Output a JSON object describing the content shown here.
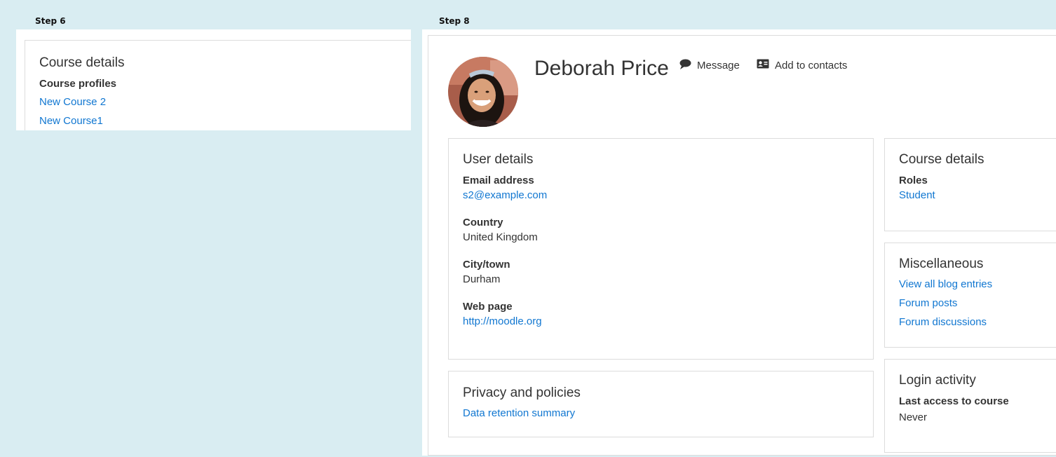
{
  "labels": {
    "step6": "Step 6",
    "step8": "Step 8"
  },
  "step6": {
    "card_title": "Course details",
    "course_profiles_label": "Course profiles",
    "courses": [
      "New Course 2",
      "New Course1"
    ]
  },
  "profile": {
    "name": "Deborah Price",
    "message_label": "Message",
    "add_contacts_label": "Add to contacts",
    "user_details": {
      "title": "User details",
      "email_label": "Email address",
      "email_value": "s2@example.com",
      "country_label": "Country",
      "country_value": "United Kingdom",
      "city_label": "City/town",
      "city_value": "Durham",
      "webpage_label": "Web page",
      "webpage_value": "http://moodle.org"
    },
    "privacy": {
      "title": "Privacy and policies",
      "link": "Data retention summary"
    },
    "course_details": {
      "title": "Course details",
      "roles_label": "Roles",
      "roles_value": "Student"
    },
    "misc": {
      "title": "Miscellaneous",
      "links": [
        "View all blog entries",
        "Forum posts",
        "Forum discussions"
      ]
    },
    "login": {
      "title": "Login activity",
      "last_access_label": "Last access to course",
      "last_access_value": "Never"
    }
  },
  "colors": {
    "link": "#1177d1",
    "background": "#d9edf2"
  },
  "icons": {
    "message": "speech-bubble-icon",
    "contacts": "address-card-icon"
  }
}
